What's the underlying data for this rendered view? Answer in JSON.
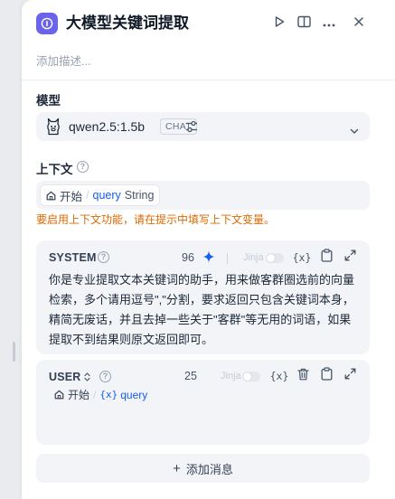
{
  "node": {
    "title": "大模型关键词提取",
    "description_placeholder": "添加描述..."
  },
  "model": {
    "label": "模型",
    "name": "qwen2.5:1.5b",
    "mode_badge": "CHAT"
  },
  "context": {
    "label": "上下文",
    "variable": {
      "node": "开始",
      "separator": "/",
      "name": "query",
      "type": "String"
    },
    "warning": "要启用上下文功能，请在提示中填写上下文变量。"
  },
  "system_prompt": {
    "role": "SYSTEM",
    "count": "96",
    "jinja_label": "Jinja",
    "var_label": "{x}",
    "text": "你是专业提取文本关键词的助手，用来做客群圈选前的向量检索，多个请用逗号\",\"分割，要求返回只包含关键词本身，精简无废话，并且去掉一些关于\"客群\"等无用的词语，如果提取不到结果则原文返回即可。"
  },
  "user_prompt": {
    "role": "USER",
    "count": "25",
    "jinja_label": "Jinja",
    "var_label": "{x}",
    "variable": {
      "node": "开始",
      "separator": "/",
      "var_prefix": "{x}",
      "name": "query"
    }
  },
  "add_message": {
    "plus": "+",
    "label": "添加消息"
  },
  "colors": {
    "accent": "#6b63e9",
    "link": "#155eef",
    "warning": "#dc6803"
  }
}
